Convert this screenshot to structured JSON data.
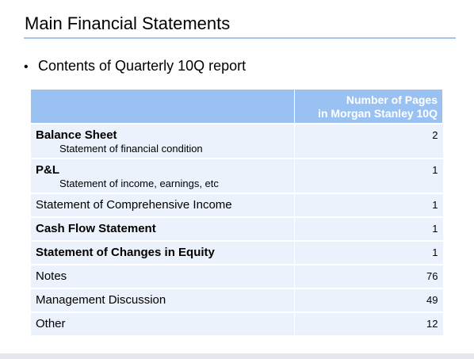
{
  "title": "Main Financial Statements",
  "bullet": "Contents of Quarterly 10Q report",
  "table": {
    "header": {
      "label_col": "",
      "value_col_line1": "Number of Pages",
      "value_col_line2": "in Morgan Stanley 10Q"
    },
    "rows": [
      {
        "label": "Balance Sheet",
        "sub": "Statement of financial condition",
        "value": "2"
      },
      {
        "label": "P&L",
        "sub": "Statement of income, earnings, etc",
        "value": "1"
      },
      {
        "label": "Statement of Comprehensive Income",
        "sub": "",
        "value": "1"
      },
      {
        "label": "Cash Flow Statement",
        "sub": "",
        "value": "1"
      },
      {
        "label": "Statement of Changes in Equity",
        "sub": "",
        "value": "1"
      },
      {
        "label": "Notes",
        "sub": "",
        "value": "76"
      },
      {
        "label": "Management Discussion",
        "sub": "",
        "value": "49"
      },
      {
        "label": "Other",
        "sub": "",
        "value": "12"
      }
    ]
  },
  "colors": {
    "header_bg": "#99c2f2",
    "row_bg": "#ebf2fb",
    "title_rule": "#a8c3ea"
  }
}
